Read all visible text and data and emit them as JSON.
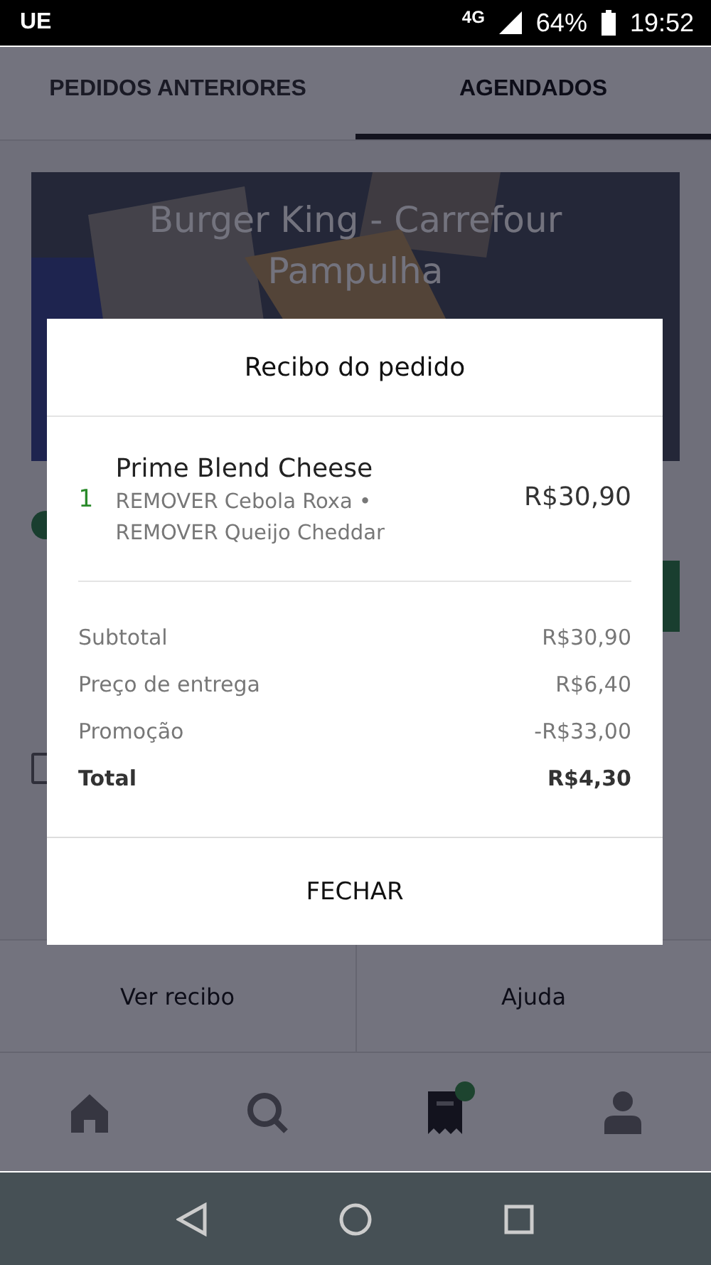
{
  "status_bar": {
    "carrier": "UE",
    "network": "4G",
    "battery": "64%",
    "time": "19:52"
  },
  "tabs": [
    {
      "label": "PEDIDOS ANTERIORES",
      "selected": false
    },
    {
      "label": "AGENDADOS",
      "selected": true
    }
  ],
  "order_card": {
    "restaurant": "Burger King - Carrefour Pampulha",
    "actions": [
      "Ver recibo",
      "Ajuda"
    ]
  },
  "bottom_nav": [
    {
      "kind": "home",
      "selected": false,
      "badge": false
    },
    {
      "kind": "search",
      "selected": false,
      "badge": false
    },
    {
      "kind": "orders",
      "selected": true,
      "badge": true
    },
    {
      "kind": "account",
      "selected": false,
      "badge": false
    }
  ],
  "dialog": {
    "title": "Recibo do pedido",
    "items": [
      {
        "quantity": "1",
        "name": "Prime Blend Cheese",
        "options": "REMOVER Cebola Roxa • REMOVER Queijo Cheddar",
        "price": "R$30,90"
      }
    ],
    "summary": [
      {
        "label": "Subtotal",
        "value": "R$30,90",
        "kind": "line"
      },
      {
        "label": "Preço de entrega",
        "value": "R$6,40",
        "kind": "line"
      },
      {
        "label": "Promoção",
        "value": "-R$33,00",
        "kind": "line"
      },
      {
        "label": "Total",
        "value": "R$4,30",
        "kind": "total"
      }
    ],
    "close_button": "FECHAR"
  }
}
